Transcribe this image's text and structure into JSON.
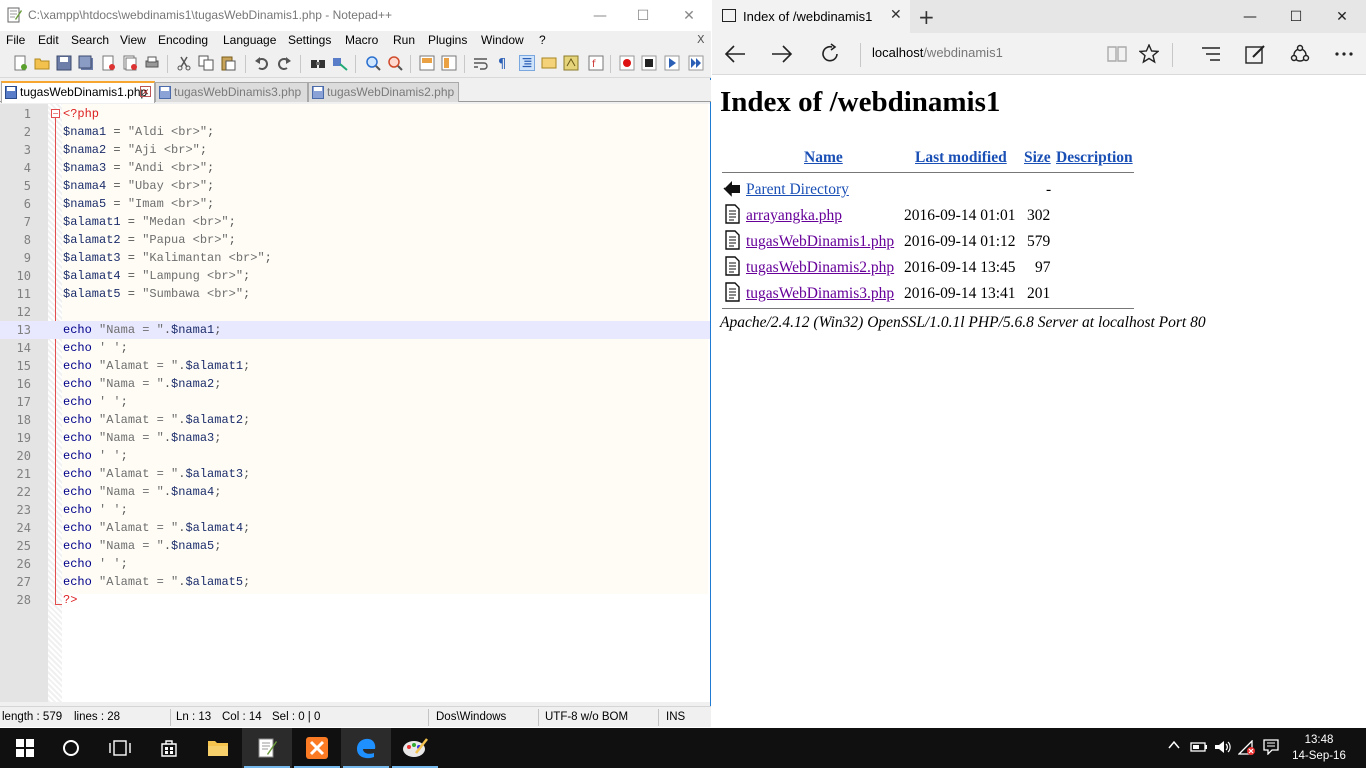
{
  "notepad": {
    "title": "C:\\xampp\\htdocs\\webdinamis1\\tugasWebDinamis1.php - Notepad++",
    "menu": [
      "File",
      "Edit",
      "Search",
      "View",
      "Encoding",
      "Language",
      "Settings",
      "Macro",
      "Run",
      "Plugins",
      "Window",
      "?"
    ],
    "menu_close": "X",
    "tabs": [
      {
        "label": "tugasWebDinamis1.php",
        "active": true
      },
      {
        "label": "tugasWebDinamis3.php",
        "active": false
      },
      {
        "label": "tugasWebDinamis2.php",
        "active": false
      }
    ],
    "current_line": 13,
    "code_lines": [
      {
        "n": "1",
        "parts": [
          [
            "php",
            "<?php"
          ]
        ]
      },
      {
        "n": "2",
        "parts": [
          [
            "var",
            "$nama1"
          ],
          [
            "op",
            " = "
          ],
          [
            "str",
            "\"Aldi <br>\""
          ],
          [
            "op",
            ";"
          ]
        ]
      },
      {
        "n": "3",
        "parts": [
          [
            "var",
            "$nama2"
          ],
          [
            "op",
            " = "
          ],
          [
            "str",
            "\"Aji <br>\""
          ],
          [
            "op",
            ";"
          ]
        ]
      },
      {
        "n": "4",
        "parts": [
          [
            "var",
            "$nama3"
          ],
          [
            "op",
            " = "
          ],
          [
            "str",
            "\"Andi <br>\""
          ],
          [
            "op",
            ";"
          ]
        ]
      },
      {
        "n": "5",
        "parts": [
          [
            "var",
            "$nama4"
          ],
          [
            "op",
            " = "
          ],
          [
            "str",
            "\"Ubay <br>\""
          ],
          [
            "op",
            ";"
          ]
        ]
      },
      {
        "n": "6",
        "parts": [
          [
            "var",
            "$nama5"
          ],
          [
            "op",
            " = "
          ],
          [
            "str",
            "\"Imam <br>\""
          ],
          [
            "op",
            ";"
          ]
        ]
      },
      {
        "n": "7",
        "parts": [
          [
            "var",
            "$alamat1"
          ],
          [
            "op",
            " = "
          ],
          [
            "str",
            "\"Medan <br>\""
          ],
          [
            "op",
            ";"
          ]
        ]
      },
      {
        "n": "8",
        "parts": [
          [
            "var",
            "$alamat2"
          ],
          [
            "op",
            " = "
          ],
          [
            "str",
            "\"Papua <br>\""
          ],
          [
            "op",
            ";"
          ]
        ]
      },
      {
        "n": "9",
        "parts": [
          [
            "var",
            "$alamat3"
          ],
          [
            "op",
            " = "
          ],
          [
            "str",
            "\"Kalimantan <br>\""
          ],
          [
            "op",
            ";"
          ]
        ]
      },
      {
        "n": "10",
        "parts": [
          [
            "var",
            "$alamat4"
          ],
          [
            "op",
            " = "
          ],
          [
            "str",
            "\"Lampung <br>\""
          ],
          [
            "op",
            ";"
          ]
        ]
      },
      {
        "n": "11",
        "parts": [
          [
            "var",
            "$alamat5"
          ],
          [
            "op",
            " = "
          ],
          [
            "str",
            "\"Sumbawa <br>\""
          ],
          [
            "op",
            ";"
          ]
        ]
      },
      {
        "n": "12",
        "parts": []
      },
      {
        "n": "13",
        "parts": [
          [
            "kw",
            "echo"
          ],
          [
            "op",
            " "
          ],
          [
            "str",
            "\"Nama = \""
          ],
          [
            "op",
            "."
          ],
          [
            "var",
            "$nama1"
          ],
          [
            "op",
            ";"
          ]
        ]
      },
      {
        "n": "14",
        "parts": [
          [
            "kw",
            "echo"
          ],
          [
            "op",
            " "
          ],
          [
            "str",
            "' '"
          ],
          [
            "op",
            ";"
          ]
        ]
      },
      {
        "n": "15",
        "parts": [
          [
            "kw",
            "echo"
          ],
          [
            "op",
            " "
          ],
          [
            "str",
            "\"Alamat = \""
          ],
          [
            "op",
            "."
          ],
          [
            "var",
            "$alamat1"
          ],
          [
            "op",
            ";"
          ]
        ]
      },
      {
        "n": "16",
        "parts": [
          [
            "kw",
            "echo"
          ],
          [
            "op",
            " "
          ],
          [
            "str",
            "\"Nama = \""
          ],
          [
            "op",
            "."
          ],
          [
            "var",
            "$nama2"
          ],
          [
            "op",
            ";"
          ]
        ]
      },
      {
        "n": "17",
        "parts": [
          [
            "kw",
            "echo"
          ],
          [
            "op",
            " "
          ],
          [
            "str",
            "' '"
          ],
          [
            "op",
            ";"
          ]
        ]
      },
      {
        "n": "18",
        "parts": [
          [
            "kw",
            "echo"
          ],
          [
            "op",
            " "
          ],
          [
            "str",
            "\"Alamat = \""
          ],
          [
            "op",
            "."
          ],
          [
            "var",
            "$alamat2"
          ],
          [
            "op",
            ";"
          ]
        ]
      },
      {
        "n": "19",
        "parts": [
          [
            "kw",
            "echo"
          ],
          [
            "op",
            " "
          ],
          [
            "str",
            "\"Nama = \""
          ],
          [
            "op",
            "."
          ],
          [
            "var",
            "$nama3"
          ],
          [
            "op",
            ";"
          ]
        ]
      },
      {
        "n": "20",
        "parts": [
          [
            "kw",
            "echo"
          ],
          [
            "op",
            " "
          ],
          [
            "str",
            "' '"
          ],
          [
            "op",
            ";"
          ]
        ]
      },
      {
        "n": "21",
        "parts": [
          [
            "kw",
            "echo"
          ],
          [
            "op",
            " "
          ],
          [
            "str",
            "\"Alamat = \""
          ],
          [
            "op",
            "."
          ],
          [
            "var",
            "$alamat3"
          ],
          [
            "op",
            ";"
          ]
        ]
      },
      {
        "n": "22",
        "parts": [
          [
            "kw",
            "echo"
          ],
          [
            "op",
            " "
          ],
          [
            "str",
            "\"Nama = \""
          ],
          [
            "op",
            "."
          ],
          [
            "var",
            "$nama4"
          ],
          [
            "op",
            ";"
          ]
        ]
      },
      {
        "n": "23",
        "parts": [
          [
            "kw",
            "echo"
          ],
          [
            "op",
            " "
          ],
          [
            "str",
            "' '"
          ],
          [
            "op",
            ";"
          ]
        ]
      },
      {
        "n": "24",
        "parts": [
          [
            "kw",
            "echo"
          ],
          [
            "op",
            " "
          ],
          [
            "str",
            "\"Alamat = \""
          ],
          [
            "op",
            "."
          ],
          [
            "var",
            "$alamat4"
          ],
          [
            "op",
            ";"
          ]
        ]
      },
      {
        "n": "25",
        "parts": [
          [
            "kw",
            "echo"
          ],
          [
            "op",
            " "
          ],
          [
            "str",
            "\"Nama = \""
          ],
          [
            "op",
            "."
          ],
          [
            "var",
            "$nama5"
          ],
          [
            "op",
            ";"
          ]
        ]
      },
      {
        "n": "26",
        "parts": [
          [
            "kw",
            "echo"
          ],
          [
            "op",
            " "
          ],
          [
            "str",
            "' '"
          ],
          [
            "op",
            ";"
          ]
        ]
      },
      {
        "n": "27",
        "parts": [
          [
            "kw",
            "echo"
          ],
          [
            "op",
            " "
          ],
          [
            "str",
            "\"Alamat = \""
          ],
          [
            "op",
            "."
          ],
          [
            "var",
            "$alamat5"
          ],
          [
            "op",
            ";"
          ]
        ]
      },
      {
        "n": "28",
        "parts": [
          [
            "php",
            "?>"
          ]
        ]
      }
    ],
    "status": {
      "length": "length : 579",
      "lines": "lines : 28",
      "ln": "Ln : 13",
      "col": "Col : 14",
      "sel": "Sel : 0 | 0",
      "eol": "Dos\\Windows",
      "encoding": "UTF-8 w/o BOM",
      "mode": "INS"
    }
  },
  "edge": {
    "tab_title": "Index of /webdinamis1",
    "address_host": "localhost",
    "address_path": "/webdinamis1",
    "page": {
      "heading": "Index of /webdinamis1",
      "columns": {
        "name": "Name",
        "last_modified": "Last modified",
        "size": "Size",
        "description": "Description"
      },
      "parent": {
        "name": "Parent Directory",
        "size": "-"
      },
      "files": [
        {
          "name": "arrayangka.php",
          "modified": "2016-09-14 01:01",
          "size": "302"
        },
        {
          "name": "tugasWebDinamis1.php",
          "modified": "2016-09-14 01:12",
          "size": "579"
        },
        {
          "name": "tugasWebDinamis2.php",
          "modified": "2016-09-14 13:45",
          "size": "97"
        },
        {
          "name": "tugasWebDinamis3.php",
          "modified": "2016-09-14 13:41",
          "size": "201"
        }
      ],
      "footer": "Apache/2.4.12 (Win32) OpenSSL/1.0.1l PHP/5.6.8 Server at localhost Port 80"
    }
  },
  "taskbar": {
    "time": "13:48",
    "date": "14-Sep-16",
    "accent_color": "#76b9ed"
  },
  "colors": {
    "link": "#1a4fb5",
    "visited": "#660099",
    "npp_tab_accent": "#f7a630",
    "current_line_bg": "#e8e8ff"
  }
}
